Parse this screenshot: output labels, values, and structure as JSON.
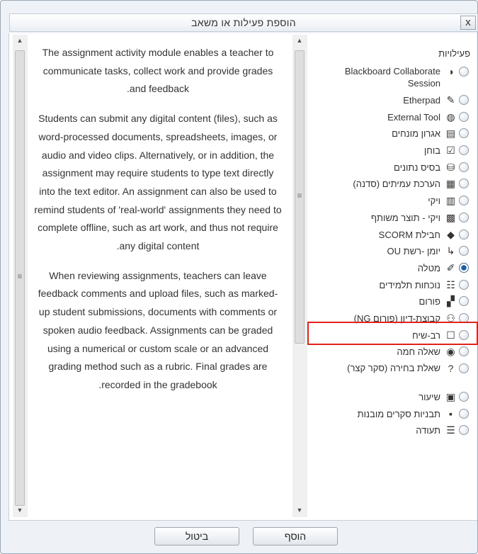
{
  "dialog": {
    "title": "הוספת פעילות או משאב",
    "close_label": "x"
  },
  "description": {
    "paragraphs": [
      "The assignment activity module enables a teacher to communicate tasks, collect work and provide grades and feedback.",
      "Students can submit any digital content (files), such as word-processed documents, spreadsheets, images, or audio and video clips. Alternatively, or in addition, the assignment may require students to type text directly into the text editor. An assignment can also be used to remind students of 'real-world' assignments they need to complete offline, such as art work, and thus not require any digital content.",
      "When reviewing assignments, teachers can leave feedback comments and upload files, such as marked-up student submissions, documents with comments or spoken audio feedback. Assignments can be graded using a numerical or custom scale or an advanced grading method such as a rubric. Final grades are recorded in the gradebook."
    ]
  },
  "activities": {
    "heading": "פעילויות",
    "selected": "מטלה",
    "items": [
      {
        "label": "Blackboard Collaborate Session",
        "icon": "bb-collaborate-icon",
        "glyph": "◑"
      },
      {
        "label": "Etherpad",
        "icon": "etherpad-icon",
        "glyph": "✎"
      },
      {
        "label": "External Tool",
        "icon": "external-tool-icon",
        "glyph": "◍"
      },
      {
        "label": "אגרון מונחים",
        "icon": "glossary-icon",
        "glyph": "▤"
      },
      {
        "label": "בוחן",
        "icon": "quiz-icon",
        "glyph": "☑"
      },
      {
        "label": "בסיס נתונים",
        "icon": "database-icon",
        "glyph": "⛁"
      },
      {
        "label": "הערכת עמיתים (סדנה)",
        "icon": "workshop-icon",
        "glyph": "▦"
      },
      {
        "label": "ויקי",
        "icon": "wiki-icon",
        "glyph": "▥"
      },
      {
        "label": "ויקי - תוצר משותף",
        "icon": "ouwiki-icon",
        "glyph": "▩"
      },
      {
        "label": "חבילת SCORM",
        "icon": "scorm-icon",
        "glyph": "◆"
      },
      {
        "label": "יומן -רשת OU",
        "icon": "oublog-icon",
        "glyph": "↳"
      },
      {
        "label": "מטלה",
        "icon": "assignment-icon",
        "glyph": "✐"
      },
      {
        "label": "נוכחות תלמידים",
        "icon": "attendance-icon",
        "glyph": "☷"
      },
      {
        "label": "פורום",
        "icon": "forum-icon",
        "glyph": "▞"
      },
      {
        "label": "קבוצת-דיון (פורום NG)",
        "icon": "forumng-icon",
        "glyph": "⚇"
      },
      {
        "label": "רב-שיח",
        "icon": "chat-icon",
        "glyph": "☐"
      },
      {
        "label": "שאלה חמה",
        "icon": "hotquestion-icon",
        "glyph": "◉"
      },
      {
        "label": "שאלת בחירה (סקר קצר)",
        "icon": "choice-icon",
        "glyph": "?"
      },
      {
        "label": "שיעור",
        "icon": "lesson-icon",
        "glyph": "▣"
      },
      {
        "label": "תבניות סקרים מובנות",
        "icon": "survey-icon",
        "glyph": "▪"
      },
      {
        "label": "תעודה",
        "icon": "certificate-icon",
        "glyph": "☰"
      }
    ]
  },
  "footer": {
    "add_label": "הוסף",
    "cancel_label": "ביטול"
  },
  "colors": {
    "highlight": "#e0231b",
    "selected_radio": "#1e5fa8"
  }
}
